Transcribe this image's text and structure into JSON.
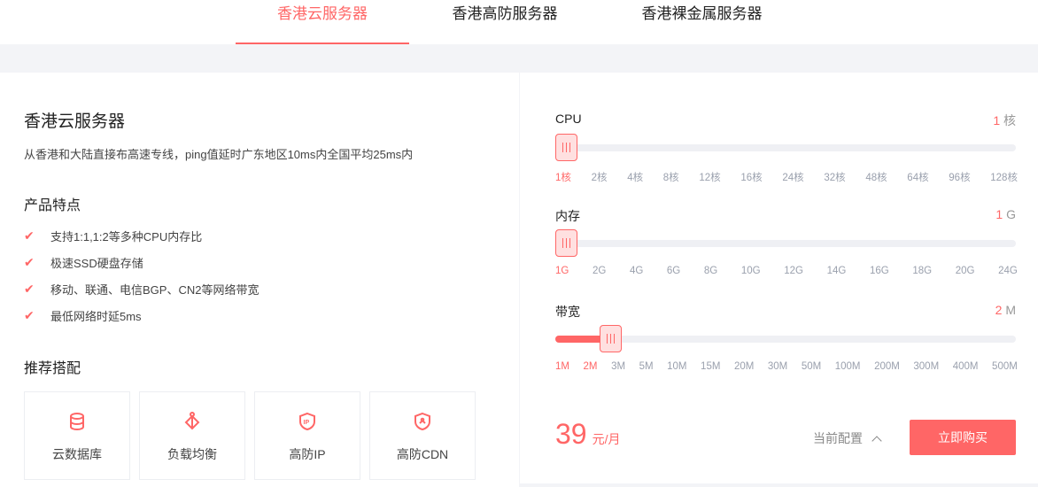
{
  "tabs": [
    "香港云服务器",
    "香港高防服务器",
    "香港裸金属服务器"
  ],
  "product": {
    "title": "香港云服务器",
    "desc": "从香港和大陆直接布高速专线，ping值延时广东地区10ms内全国平均25ms内",
    "features_title": "产品特点",
    "features": [
      "支持1:1,1:2等多种CPU内存比",
      "极速SSD硬盘存储",
      "移动、联通、电信BGP、CN2等网络带宽",
      "最低网络时延5ms"
    ],
    "recommend_title": "推荐搭配",
    "recommend": [
      "云数据库",
      "负载均衡",
      "高防IP",
      "高防CDN"
    ]
  },
  "config": {
    "cpu": {
      "label": "CPU",
      "value": "1",
      "unit": "核",
      "selected_index": 0,
      "ticks": [
        "1核",
        "2核",
        "4核",
        "8核",
        "12核",
        "16核",
        "24核",
        "32核",
        "48核",
        "64核",
        "96核",
        "128核"
      ]
    },
    "memory": {
      "label": "内存",
      "value": "1",
      "unit": "G",
      "selected_index": 0,
      "ticks": [
        "1G",
        "2G",
        "4G",
        "6G",
        "8G",
        "10G",
        "12G",
        "14G",
        "16G",
        "18G",
        "20G",
        "24G"
      ]
    },
    "bandwidth": {
      "label": "带宽",
      "value": "2",
      "unit": "M",
      "selected_index": 1,
      "ticks": [
        "1M",
        "2M",
        "3M",
        "5M",
        "10M",
        "15M",
        "20M",
        "30M",
        "50M",
        "100M",
        "200M",
        "300M",
        "400M",
        "500M"
      ]
    }
  },
  "price": {
    "amount": "39",
    "unit": "元/月"
  },
  "current_config": "当前配置",
  "buy": "立即购买",
  "accent": "#ff6666"
}
